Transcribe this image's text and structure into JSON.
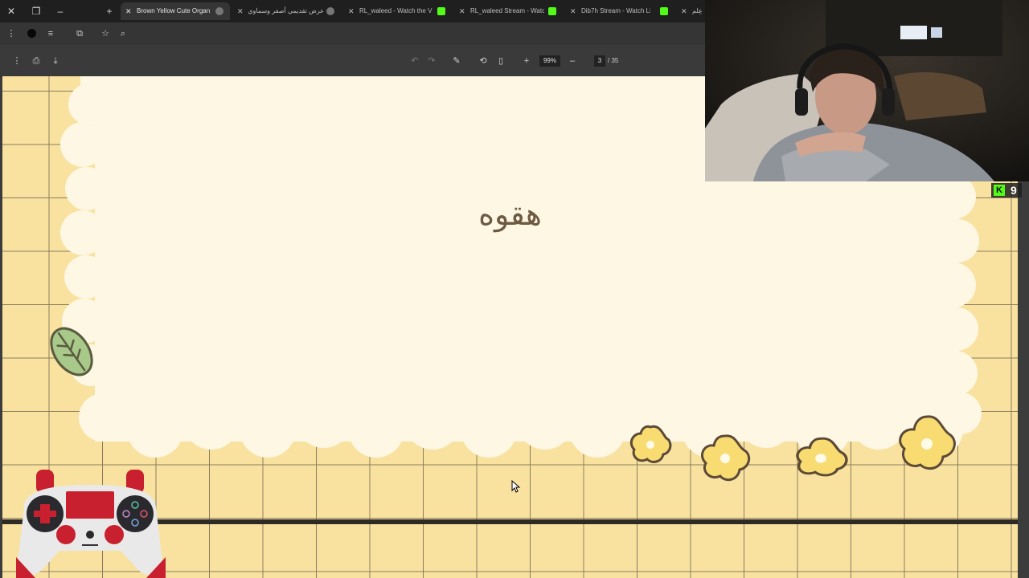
{
  "browser": {
    "tabs": [
      {
        "title": "Brown Yellow Cute Organ",
        "active": true,
        "favicon": "globe-icon"
      },
      {
        "title": "عرض تقديمي أصفر وسماوي",
        "active": false,
        "favicon": "globe-icon"
      },
      {
        "title": "RL_waleed - Watch the V",
        "active": false,
        "favicon": "kick-icon"
      },
      {
        "title": "RL_waleed Stream - Watc",
        "active": false,
        "favicon": "kick-icon"
      },
      {
        "title": "Dib7h Stream - Watch Li",
        "active": false,
        "favicon": "kick-icon"
      },
      {
        "title": "عِلم",
        "active": false,
        "favicon": "none"
      }
    ]
  },
  "pdf_viewer": {
    "zoom": "99%",
    "page_current": "3",
    "page_total": "/ 35"
  },
  "slide": {
    "title": "هقوه"
  },
  "stream_overlay": {
    "viewer_count": "9"
  },
  "colors": {
    "accent_kick": "#53fc18",
    "slide_bg": "#f9e2a0",
    "cloud": "#fdf7e3",
    "title_text": "#6e5a42"
  }
}
